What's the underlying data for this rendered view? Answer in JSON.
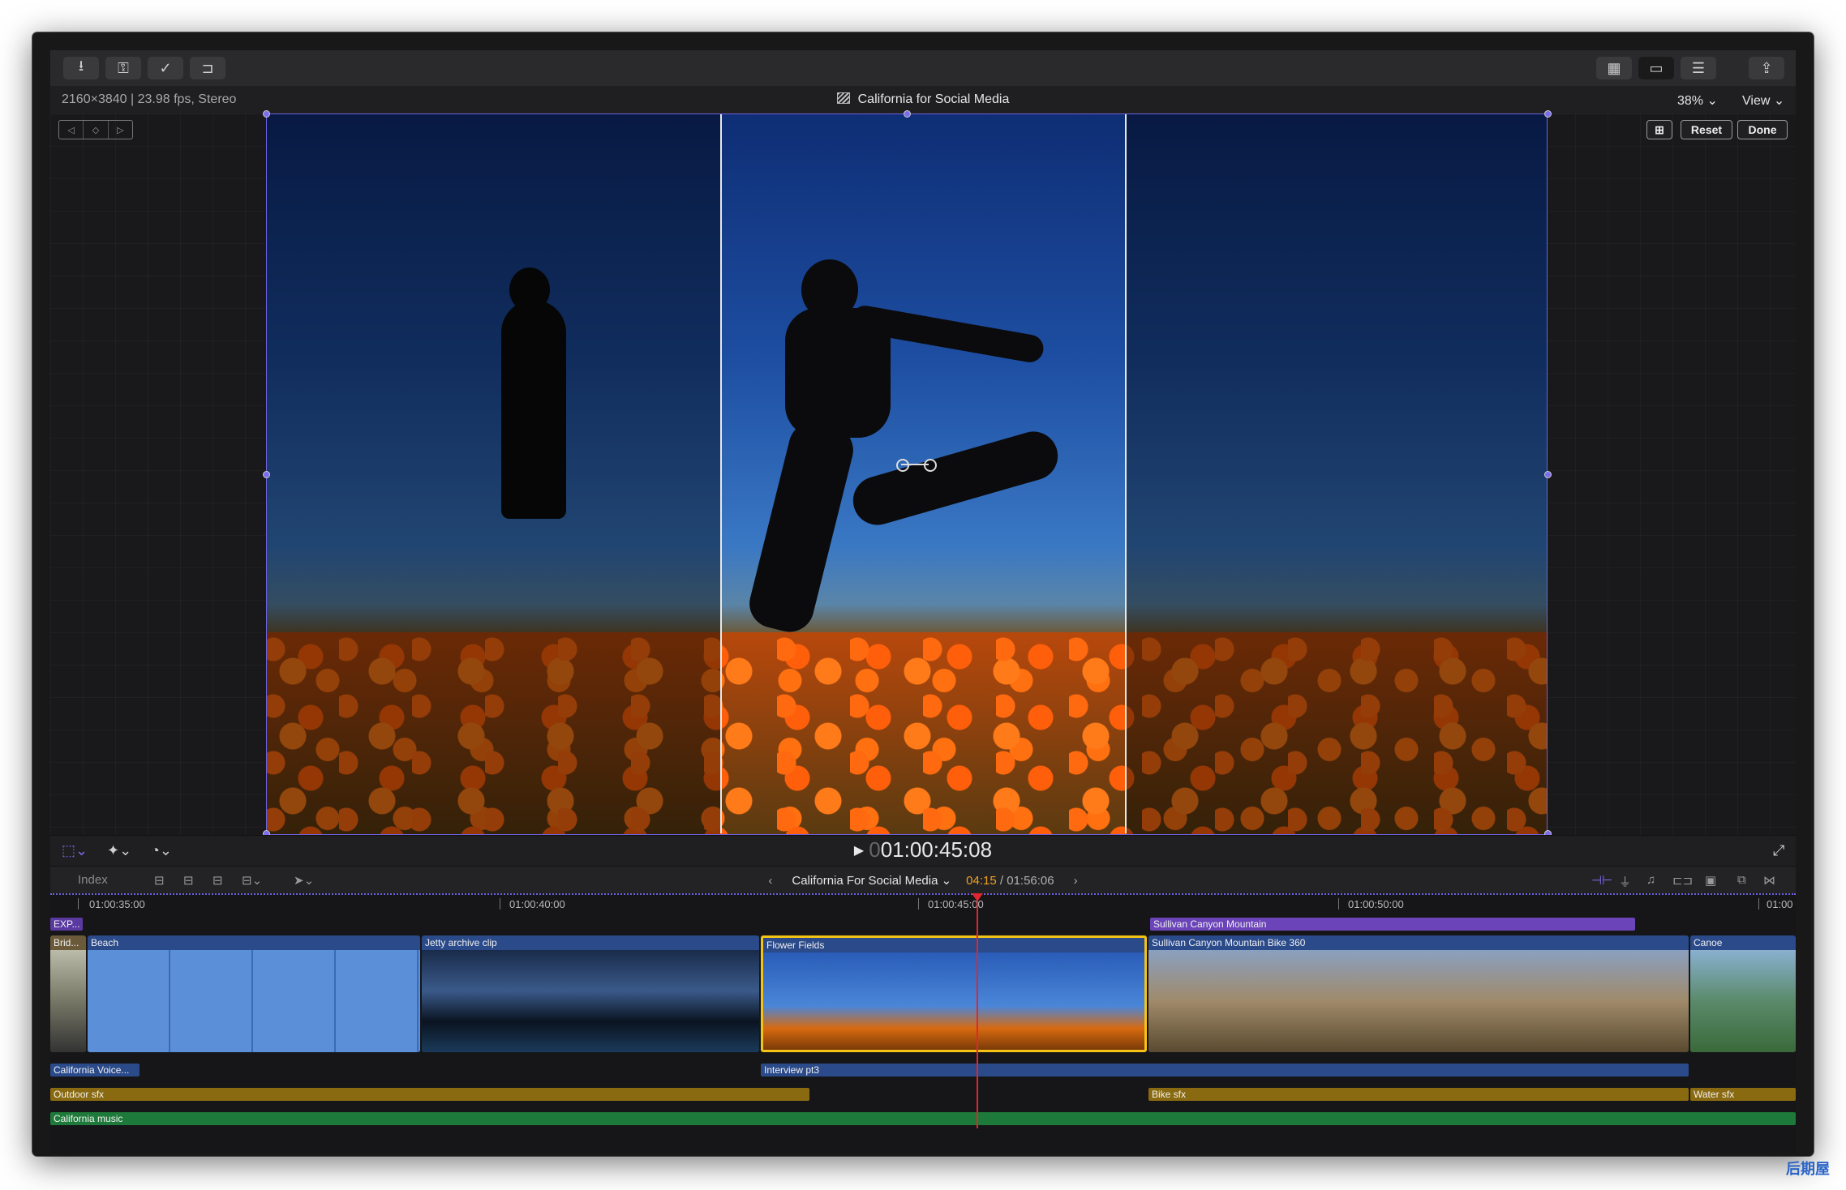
{
  "toolbar": {
    "left_icons": [
      "import-icon",
      "keywords-icon",
      "analyze-icon",
      "share-tag-icon"
    ],
    "right_icons": [
      "grid-view-icon",
      "filmstrip-view-icon",
      "inspector-icon",
      "share-icon"
    ]
  },
  "viewer": {
    "format": "2160×3840 | 23.98 fps, Stereo",
    "project_title": "California for Social Media",
    "zoom": "38% ⌄",
    "view_menu": "View ⌄",
    "reset_label": "Reset",
    "done_label": "Done"
  },
  "transport": {
    "timecode": "01:00:45:08",
    "timecode_dim": "0"
  },
  "timeline_header": {
    "index_label": "Index",
    "project_name": "California For Social Media ⌄",
    "current_time": "04:15",
    "duration": "/ 01:56:06"
  },
  "ruler": {
    "labels": [
      "01:00:35:00",
      "01:00:40:00",
      "01:00:45:00",
      "01:00:50:00",
      "01:00"
    ]
  },
  "connected_above": [
    {
      "label": "EXP..."
    },
    {
      "label": "Sullivan Canyon Mountain"
    }
  ],
  "clips": [
    {
      "label": "Brid..."
    },
    {
      "label": "Beach"
    },
    {
      "label": "Jetty archive clip"
    },
    {
      "label": "Flower Fields"
    },
    {
      "label": "Sullivan Canyon Mountain Bike 360"
    },
    {
      "label": "Canoe"
    }
  ],
  "audio_lanes": [
    {
      "label": "California Voice..."
    },
    {
      "label": "Interview pt3"
    },
    {
      "label": "Outdoor sfx"
    },
    {
      "label": "Bike sfx"
    },
    {
      "label": "Water sfx"
    },
    {
      "label": "California music"
    }
  ],
  "colors": {
    "accent": "#6e62e0",
    "selection": "#f3c315",
    "playhead": "#e0262e",
    "video_clip": "#2a4a8a",
    "audio_sfx": "#8a6a10",
    "audio_music": "#1e7a3a",
    "title_bar": "#5a3aa0"
  },
  "watermark": "后期屋"
}
